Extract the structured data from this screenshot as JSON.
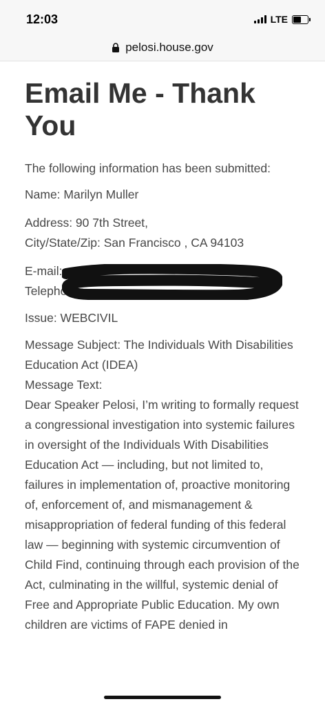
{
  "status_bar": {
    "time": "12:03",
    "network": "LTE",
    "battery_level": 0.55
  },
  "browser": {
    "url": "pelosi.house.gov",
    "lock_icon": "lock-icon"
  },
  "page": {
    "title": "Email Me - Thank You",
    "intro": "The following information has been submitted:",
    "name_line": "Name: Marilyn Muller",
    "address_line": "Address: 90 7th Street,",
    "city_line": "City/State/Zip: San Francisco , CA 94103",
    "email_label": "E-mail:",
    "phone_label": "Telephone:",
    "issue_line": "Issue: WEBCIVIL",
    "subject_line": "Message Subject: The Individuals With Disabilities Education Act (IDEA)",
    "message_label": "Message Text:",
    "message_text": "Dear Speaker Pelosi, I’m writing to formally request a congressional investigation into systemic failures in oversight of the Individuals With Disabilities Education Act — including, but not limited to, failures in implementation of, proactive monitoring of, enforcement of, and mismanagement & misappropriation of federal funding of this federal law — beginning with systemic circumvention of Child Find, continuing through each provision of the Act, culminating in the willful, systemic denial of Free and Appropriate Public Education. My own children are victims of FAPE denied in"
  },
  "colors": {
    "status_bg": "#f7f7f7",
    "title": "#333333",
    "body_text": "#474747",
    "redaction": "#111111"
  }
}
